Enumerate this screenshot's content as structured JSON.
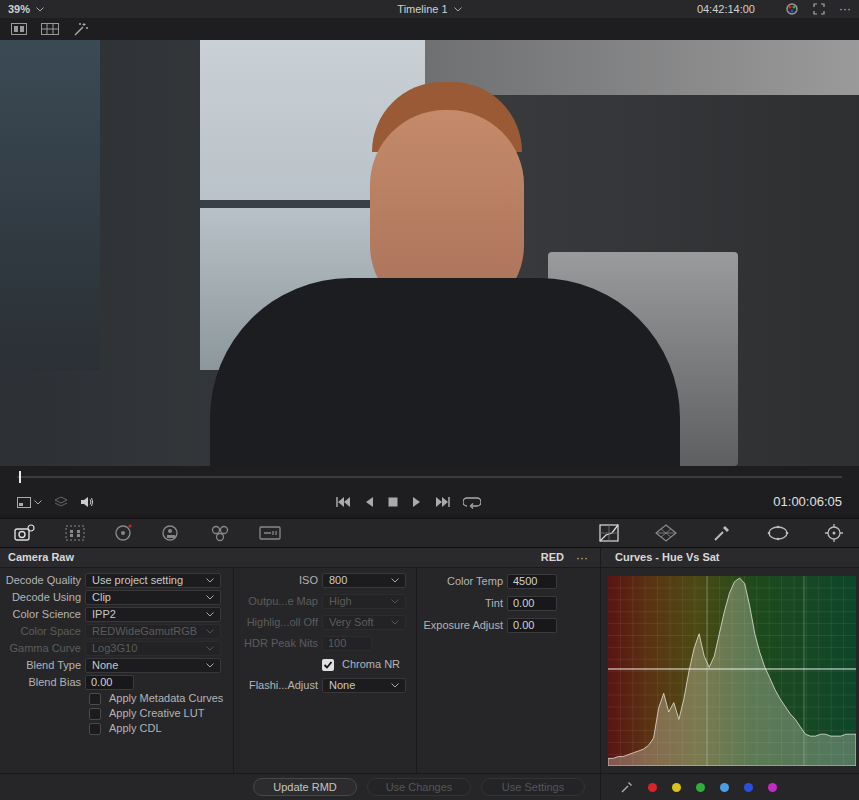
{
  "topbar": {
    "zoom": "39%",
    "timeline": "Timeline 1",
    "timecode": "04:42:14:00",
    "more": "···"
  },
  "viewer": {
    "playhead": 0.003,
    "timecode": "01:00:06:05"
  },
  "panel": {
    "title": "Camera Raw",
    "format": "RED",
    "more": "···"
  },
  "decode_settings": [
    {
      "label": "Decode Quality",
      "value": "Use project setting",
      "kind": "select",
      "disabled": false
    },
    {
      "label": "Decode Using",
      "value": "Clip",
      "kind": "select",
      "disabled": false
    },
    {
      "label": "Color Science",
      "value": "IPP2",
      "kind": "select",
      "disabled": false
    },
    {
      "label": "Color Space",
      "value": "REDWideGamutRGB",
      "kind": "select",
      "disabled": true
    },
    {
      "label": "Gamma Curve",
      "value": "Log3G10",
      "kind": "select",
      "disabled": true
    },
    {
      "label": "Blend Type",
      "value": "None",
      "kind": "select",
      "disabled": false
    },
    {
      "label": "Blend Bias",
      "value": "0.00",
      "kind": "input",
      "disabled": false
    }
  ],
  "decode_options": [
    {
      "label": "Apply Metadata Curves",
      "checked": false
    },
    {
      "label": "Apply Creative LUT",
      "checked": false
    },
    {
      "label": "Apply CDL",
      "checked": false
    }
  ],
  "image_settings": [
    {
      "label": "ISO",
      "value": "800",
      "kind": "select",
      "disabled": false
    },
    {
      "label": "Outpu...e Map",
      "value": "High",
      "kind": "select",
      "disabled": true
    },
    {
      "label": "Highlig...oll Off",
      "value": "Very Soft",
      "kind": "select",
      "disabled": true
    },
    {
      "label": "HDR Peak Nits",
      "value": "100",
      "kind": "input",
      "disabled": true
    },
    {
      "label": "Chroma NR",
      "kind": "checkbox",
      "checked": true,
      "disabled": false
    },
    {
      "label": "Flashi...Adjust",
      "value": "None",
      "kind": "select",
      "disabled": false
    }
  ],
  "color_settings": [
    {
      "label": "Color Temp",
      "value": "4500"
    },
    {
      "label": "Tint",
      "value": "0.00"
    },
    {
      "label": "Exposure Adjust",
      "value": "0.00"
    }
  ],
  "buttons": [
    {
      "label": "Update RMD",
      "disabled": false
    },
    {
      "label": "Use Changes",
      "disabled": true
    },
    {
      "label": "Use Settings",
      "disabled": true
    }
  ],
  "curves": {
    "title": "Curves - Hue Vs Sat",
    "histogram": [
      3,
      3,
      4,
      4,
      5,
      6,
      7,
      8,
      10,
      14,
      30,
      38,
      28,
      33,
      24,
      35,
      50,
      62,
      70,
      58,
      52,
      58,
      70,
      82,
      92,
      98,
      100,
      97,
      85,
      70,
      60,
      52,
      46,
      40,
      35,
      31,
      27,
      24,
      20,
      16,
      15,
      15,
      16,
      16,
      15,
      15,
      15,
      16,
      16,
      16
    ],
    "swatches": [
      {
        "color": "#d8232a"
      },
      {
        "color": "#d9c21c"
      },
      {
        "color": "#2fae3a"
      },
      {
        "color": "#4a9fe0"
      },
      {
        "color": "#2a4fe0"
      },
      {
        "color": "#c52ac6"
      }
    ]
  }
}
